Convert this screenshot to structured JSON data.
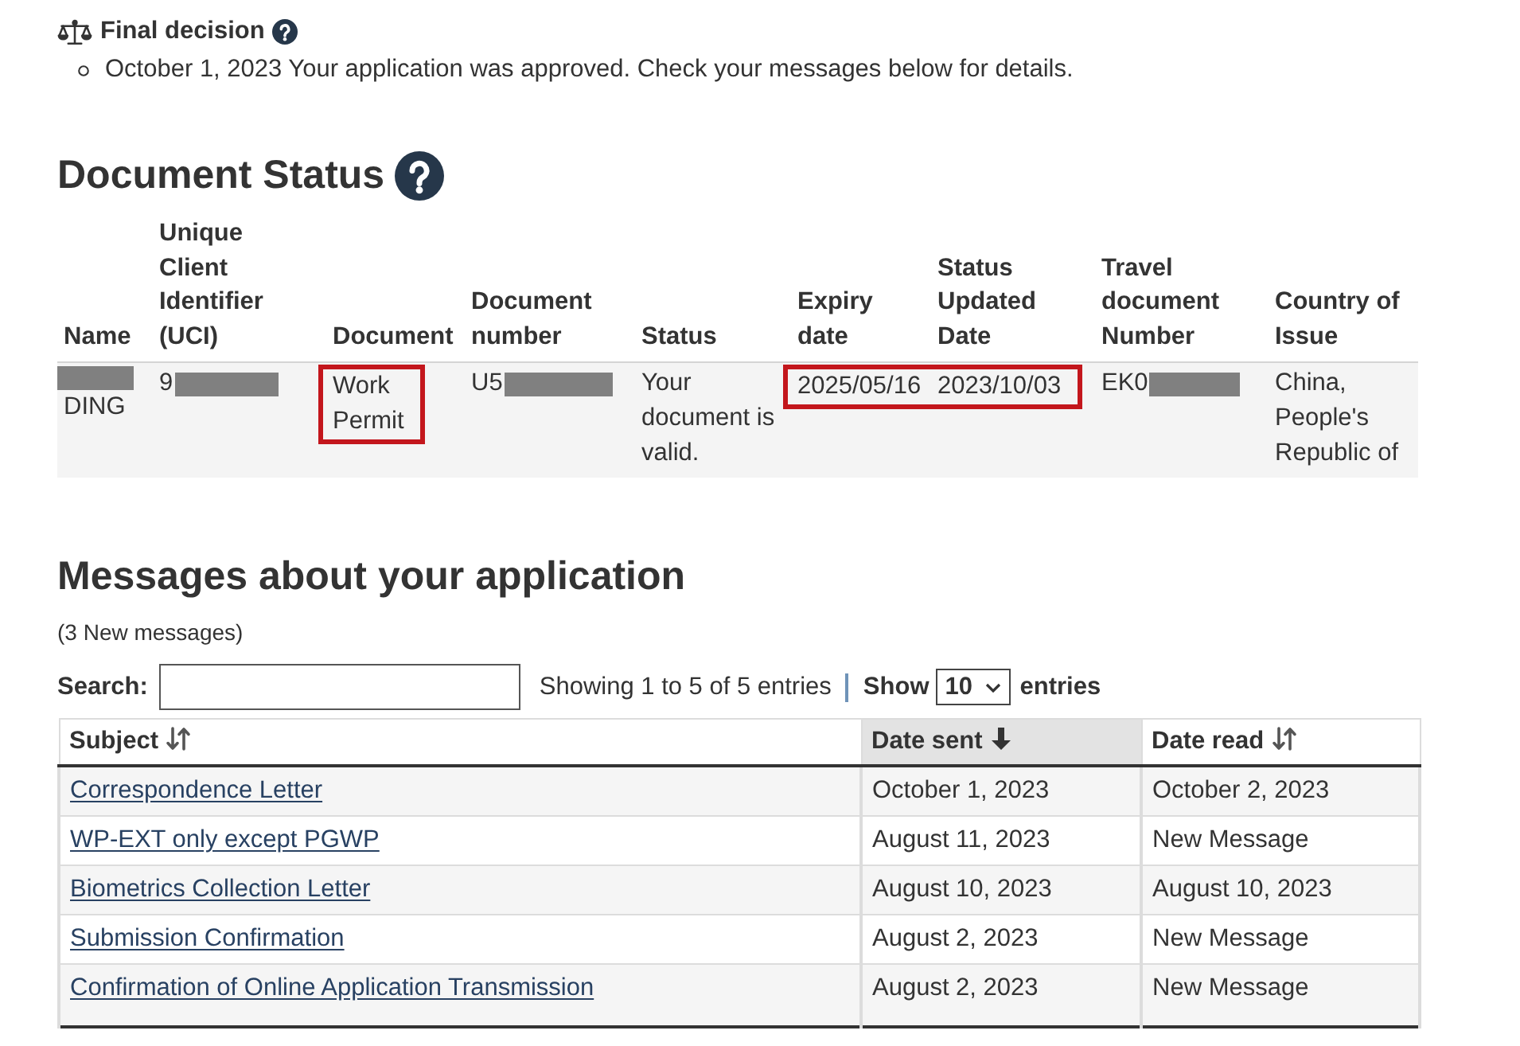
{
  "final_decision": {
    "title": "Final decision",
    "help": true,
    "items": [
      "October 1, 2023 Your application was approved. Check your messages below for details."
    ]
  },
  "document_status": {
    "title": "Document Status",
    "help": true,
    "table": {
      "columns": [
        "Name",
        "Unique Client Identifier (UCI)",
        "Document",
        "Document number",
        "Status",
        "Expiry date",
        "Status Updated Date",
        "Travel document Number",
        "Country of Issue"
      ],
      "rows": [
        {
          "cells": [
            {
              "highlighted": false,
              "parts": [
                {
                  "kind": "redaction"
                },
                {
                  "kind": "text",
                  "text": "DING"
                }
              ]
            },
            {
              "highlighted": false,
              "parts": [
                {
                  "kind": "text",
                  "text": "9"
                },
                {
                  "kind": "redaction"
                }
              ]
            },
            {
              "highlighted": true,
              "parts": [
                {
                  "kind": "text",
                  "text": "Work Permit"
                }
              ]
            },
            {
              "highlighted": false,
              "parts": [
                {
                  "kind": "text",
                  "text": "U5"
                },
                {
                  "kind": "redaction"
                }
              ]
            },
            {
              "highlighted": false,
              "parts": [
                {
                  "kind": "text",
                  "text": "Your document is valid."
                }
              ]
            },
            {
              "highlighted": true,
              "parts": [
                {
                  "kind": "text",
                  "text": "2025/05/16"
                }
              ]
            },
            {
              "highlighted": true,
              "parts": [
                {
                  "kind": "text",
                  "text": "2023/10/03"
                }
              ]
            },
            {
              "highlighted": false,
              "parts": [
                {
                  "kind": "text",
                  "text": "EK0"
                },
                {
                  "kind": "redaction"
                }
              ]
            },
            {
              "highlighted": false,
              "parts": [
                {
                  "kind": "text",
                  "text": "China, People's Republic of"
                }
              ]
            }
          ]
        }
      ]
    }
  },
  "messages": {
    "title": "Messages about your application",
    "count": "(3 New messages)",
    "search": {
      "label": "Search:"
    },
    "info": "Showing 1 to 5 of 5 entries",
    "length": {
      "before": "Show",
      "value": "10",
      "after": "entries"
    },
    "table": {
      "columns": [
        {
          "label": "Subject",
          "sorted": false
        },
        {
          "label": "Date sent",
          "sorted": true,
          "descending": true
        },
        {
          "label": "Date read",
          "sorted": false
        }
      ],
      "rows": [
        {
          "subject": "Correspondence Letter",
          "date_sent": "October 1, 2023",
          "date_read": "October 2, 2023"
        },
        {
          "subject": "WP-EXT only except PGWP",
          "date_sent": "August 11, 2023",
          "date_read": "New Message"
        },
        {
          "subject": "Biometrics Collection Letter",
          "date_sent": "August 10, 2023",
          "date_read": "August 10, 2023"
        },
        {
          "subject": "Submission Confirmation",
          "date_sent": "August 2, 2023",
          "date_read": "New Message"
        },
        {
          "subject": "Confirmation of Online Application Transmission",
          "date_sent": "August 2, 2023",
          "date_read": "New Message"
        }
      ]
    }
  }
}
